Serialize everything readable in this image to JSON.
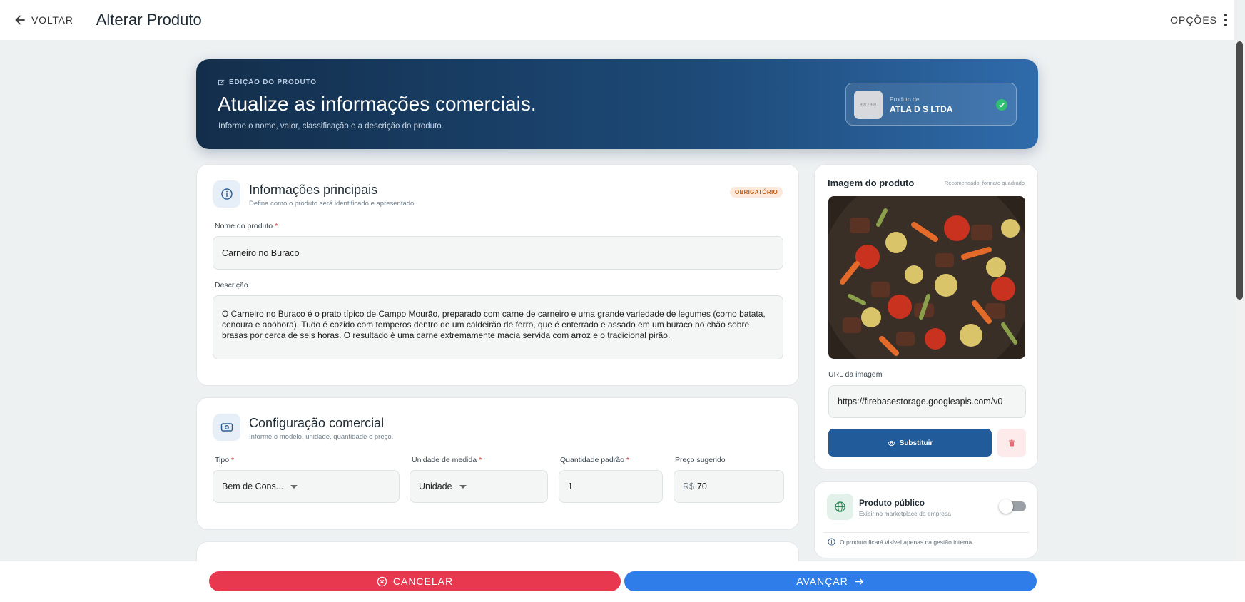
{
  "header": {
    "back_label": "VOLTAR",
    "title": "Alterar Produto",
    "options_label": "OPÇÕES"
  },
  "hero": {
    "eyebrow": "EDIÇÃO DO PRODUTO",
    "title": "Atualize as informações comerciais.",
    "subtitle": "Informe o nome, valor, classificação e a descrição do produto.",
    "company_thumb_text": "400 × 400",
    "company_label": "Produto de",
    "company_name": "ATLA D S LTDA"
  },
  "main_info": {
    "title": "Informações principais",
    "subtitle": "Defina como o produto será identificado e apresentado.",
    "badge": "OBRIGATÓRIO",
    "name_label": "Nome do produto",
    "name_value": "Carneiro no Buraco",
    "description_label": "Descrição",
    "description_value": "O Carneiro no Buraco é o prato típico de Campo Mourão, preparado com carne de carneiro e uma grande variedade de legumes (como batata, cenoura e abóbora). Tudo é cozido com temperos dentro de um caldeirão de ferro, que é enterrado e assado em um buraco no chão sobre brasas por cerca de seis horas. O resultado é uma carne extremamente macia servida com arroz e o tradicional pirão."
  },
  "commercial": {
    "title": "Configuração comercial",
    "subtitle": "Informe o modelo, unidade, quantidade e preço.",
    "type_label": "Tipo",
    "type_value": "Bem de Cons...",
    "unit_label": "Unidade de medida",
    "unit_value": "Unidade",
    "qty_label": "Quantidade padrão",
    "qty_value": "1",
    "price_label": "Preço sugerido",
    "price_prefix": "R$",
    "price_value": "70"
  },
  "image_card": {
    "title": "Imagem do produto",
    "recommendation": "Recomendado: formato quadrado",
    "url_label": "URL da imagem",
    "url_value": "https://firebasestorage.googleapis.com/v0",
    "replace_label": "Substituir"
  },
  "public_card": {
    "title": "Produto público",
    "subtitle": "Exibir no marketplace da empresa",
    "enabled": false,
    "note": "O produto ficará visível apenas na gestão interna."
  },
  "footer": {
    "cancel_label": "CANCELAR",
    "next_label": "AVANÇAR"
  },
  "colors": {
    "primary": "#215b99",
    "cancel": "#e8384f",
    "next": "#2f7de8",
    "hero_dark": "#132e4b",
    "hero_light": "#2f6bab"
  }
}
